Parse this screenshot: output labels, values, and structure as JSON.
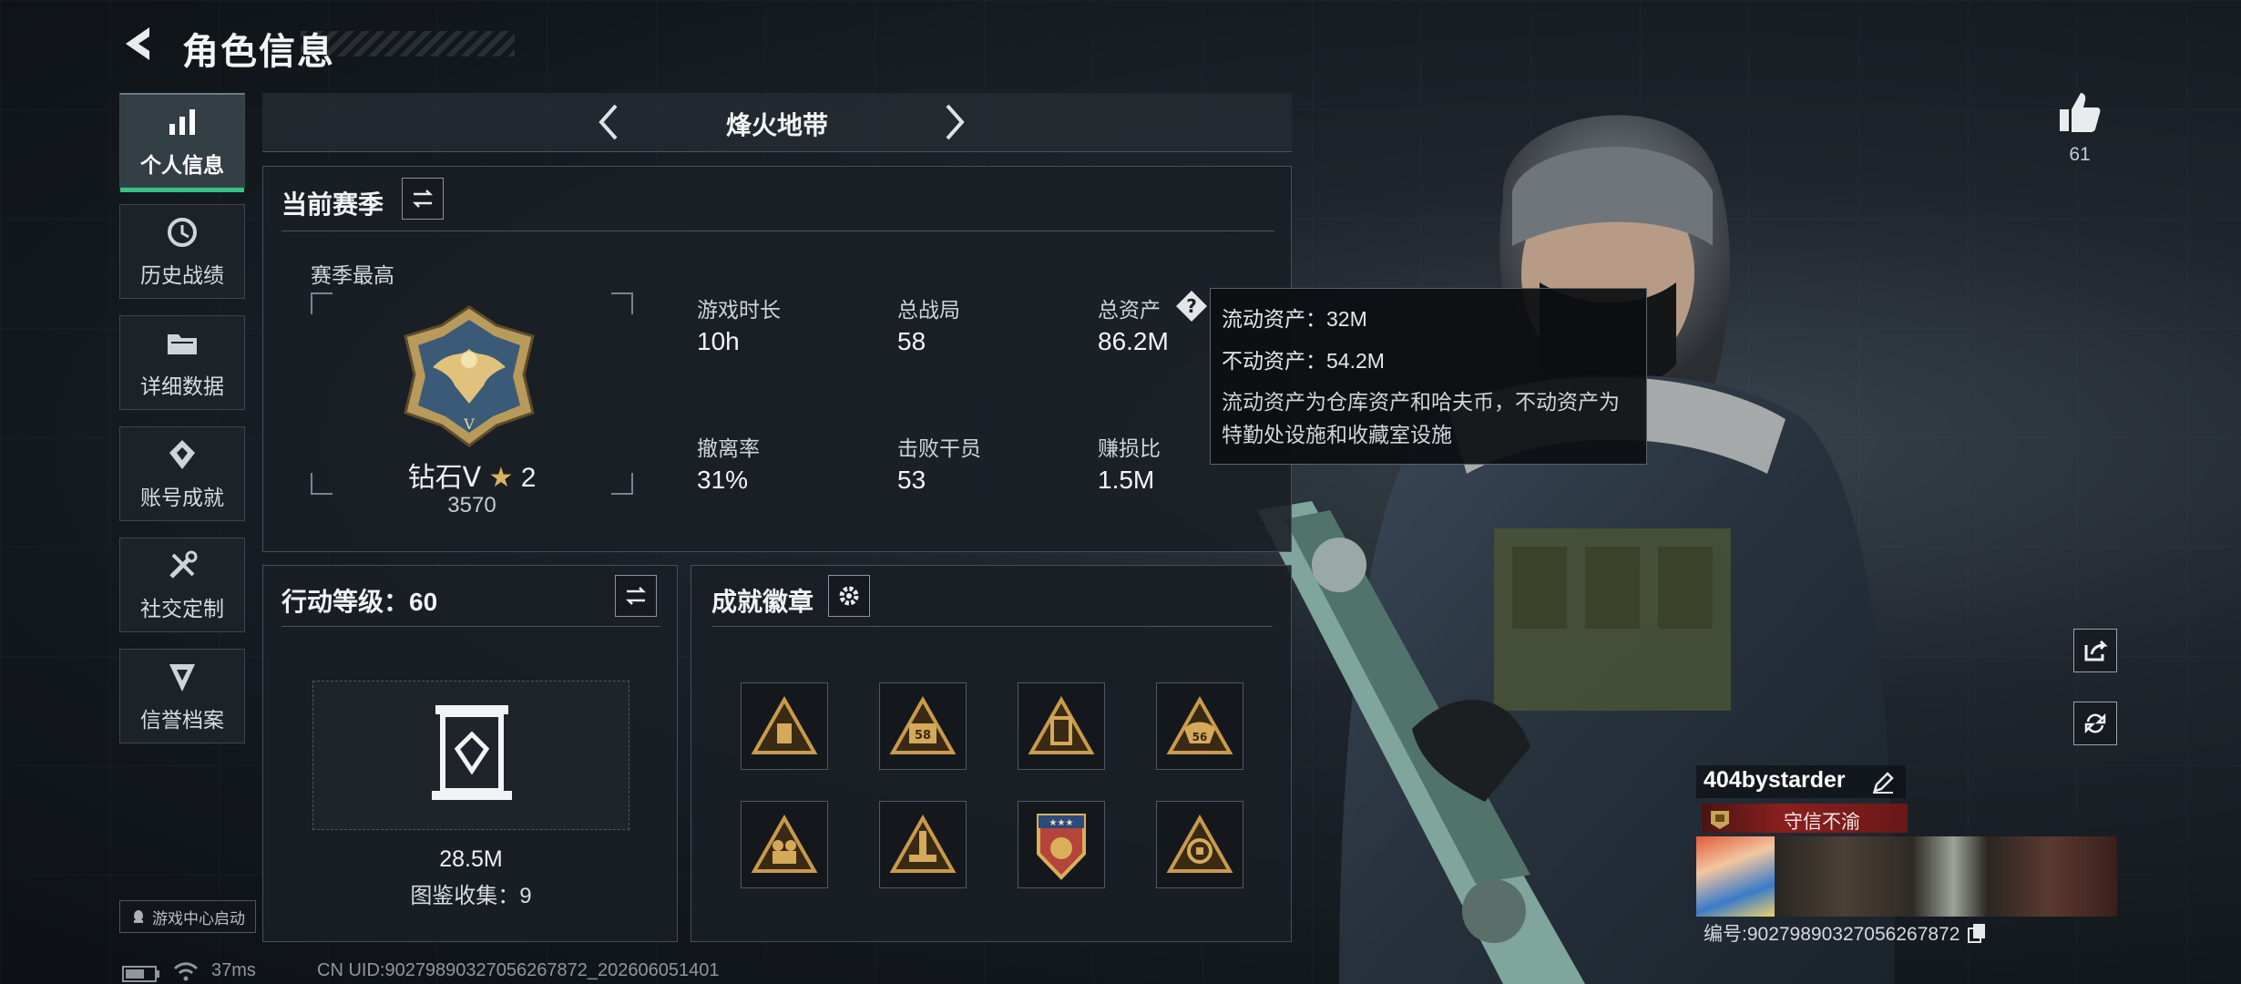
{
  "header": {
    "title": "角色信息"
  },
  "nav": [
    {
      "label": "个人信息",
      "icon": "bar-chart-icon",
      "active": true
    },
    {
      "label": "历史战绩",
      "icon": "history-icon",
      "active": false
    },
    {
      "label": "详细数据",
      "icon": "folder-icon",
      "active": false
    },
    {
      "label": "账号成就",
      "icon": "achievement-icon",
      "active": false
    },
    {
      "label": "社交定制",
      "icon": "tools-icon",
      "active": false
    },
    {
      "label": "信誉档案",
      "icon": "shield-icon",
      "active": false
    }
  ],
  "mode": {
    "title": "烽火地带"
  },
  "season": {
    "title": "当前赛季",
    "best_label": "赛季最高",
    "rank_name": "钻石Ⅴ",
    "rank_stars": "2",
    "rank_points": "3570",
    "stats": [
      {
        "label": "游戏时长",
        "value": "10h"
      },
      {
        "label": "总战局",
        "value": "58"
      },
      {
        "label": "总资产",
        "value": "86.2M"
      },
      {
        "label": "撤离率",
        "value": "31%"
      },
      {
        "label": "击败干员",
        "value": "53"
      },
      {
        "label": "赚损比",
        "value": "1.5M"
      }
    ]
  },
  "tooltip": {
    "liquid": "流动资产：32M",
    "fixed": "不动资产：54.2M",
    "desc": "流动资产为仓库资产和哈夫币，不动资产为特勤处设施和收藏室设施"
  },
  "action": {
    "title": "行动等级：60",
    "value": "28.5M",
    "collection": "图鉴收集：9"
  },
  "badges": {
    "title": "成就徽章",
    "items": [
      "",
      "58",
      "",
      "56",
      "",
      "",
      "",
      ""
    ]
  },
  "likes": {
    "count": "61"
  },
  "player": {
    "name": "404bystarder",
    "title_badge": "守信不渝",
    "id_text": "编号:9027989032705626787​2"
  },
  "footer": {
    "game_center": "游戏中心启动",
    "ping": "37ms",
    "uid": "CN UID:9027989032705626787​2_202606051401"
  },
  "colors": {
    "accent": "#33c481",
    "title_badge_bg": "#8a1f1f",
    "gold": "#c9a35a"
  }
}
